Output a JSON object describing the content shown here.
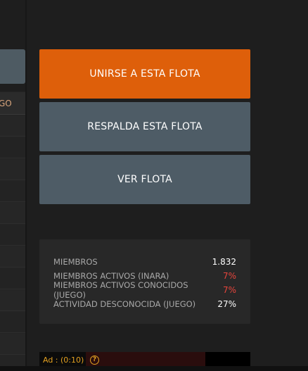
{
  "left_table": {
    "header_fragment": "GO"
  },
  "actions": {
    "join_label": "UNIRSE A ESTA FLOTA",
    "support_label": "RESPALDA ESTA FLOTA",
    "view_label": "VER FLOTA"
  },
  "stats": [
    {
      "label": "MIEMBROS",
      "value": "1.832",
      "highlight": false
    },
    {
      "label": "MIEMBROS ACTIVOS (INARA)",
      "value": "7%",
      "highlight": true
    },
    {
      "label": "MIEMBROS ACTIVOS CONOCIDOS (JUEGO)",
      "value": "7%",
      "highlight": true
    },
    {
      "label": "ACTIVIDAD DESCONOCIDA (JUEGO)",
      "value": "27%",
      "highlight": false
    }
  ],
  "ad": {
    "label": "Ad : (0:10)",
    "help_icon": "?"
  },
  "colors": {
    "accent_orange": "#de5f0a",
    "button_slate": "#4e5c66",
    "negative_red": "#e8453c",
    "ad_yellow": "#e3a020"
  }
}
